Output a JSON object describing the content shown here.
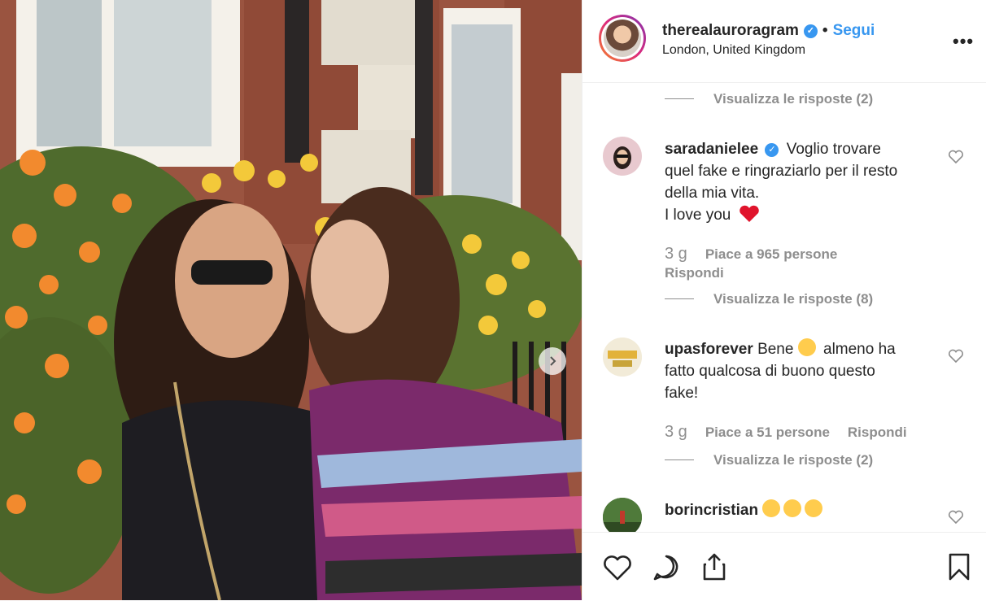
{
  "post": {
    "username": "therealauroragram",
    "follow_label": "Segui",
    "location": "London, United Kingdom",
    "more_label": "•••",
    "separator": "•"
  },
  "comments": {
    "replies_1": "Visualizza le risposte (2)",
    "items": [
      {
        "username": "saradanielee",
        "verified": true,
        "text_lines": [
          "Voglio trovare",
          "quel fake e ringraziarlo per il resto",
          "della mia vita.",
          "I love you"
        ],
        "time": "3 g",
        "likes": "Piace a 965 persone",
        "reply": "Rispondi",
        "replies": "Visualizza le risposte (8)"
      },
      {
        "username": "upasforever",
        "text_a": "Bene",
        "text_b": "almeno ha",
        "text_lines": [
          "fatto qualcosa di buono questo",
          "fake!"
        ],
        "time": "3 g",
        "likes": "Piace a 51 persone",
        "reply": "Rispondi",
        "replies": "Visualizza le risposte (2)"
      },
      {
        "username": "borincristian"
      }
    ]
  },
  "icons": [
    "heart-icon",
    "comment-icon",
    "share-icon",
    "bookmark-icon",
    "verified-icon",
    "next-arrow-icon"
  ],
  "colors": {
    "accent": "#3897f0",
    "muted": "#8e8e8e",
    "text": "#262626",
    "heart": "#e0142c"
  }
}
